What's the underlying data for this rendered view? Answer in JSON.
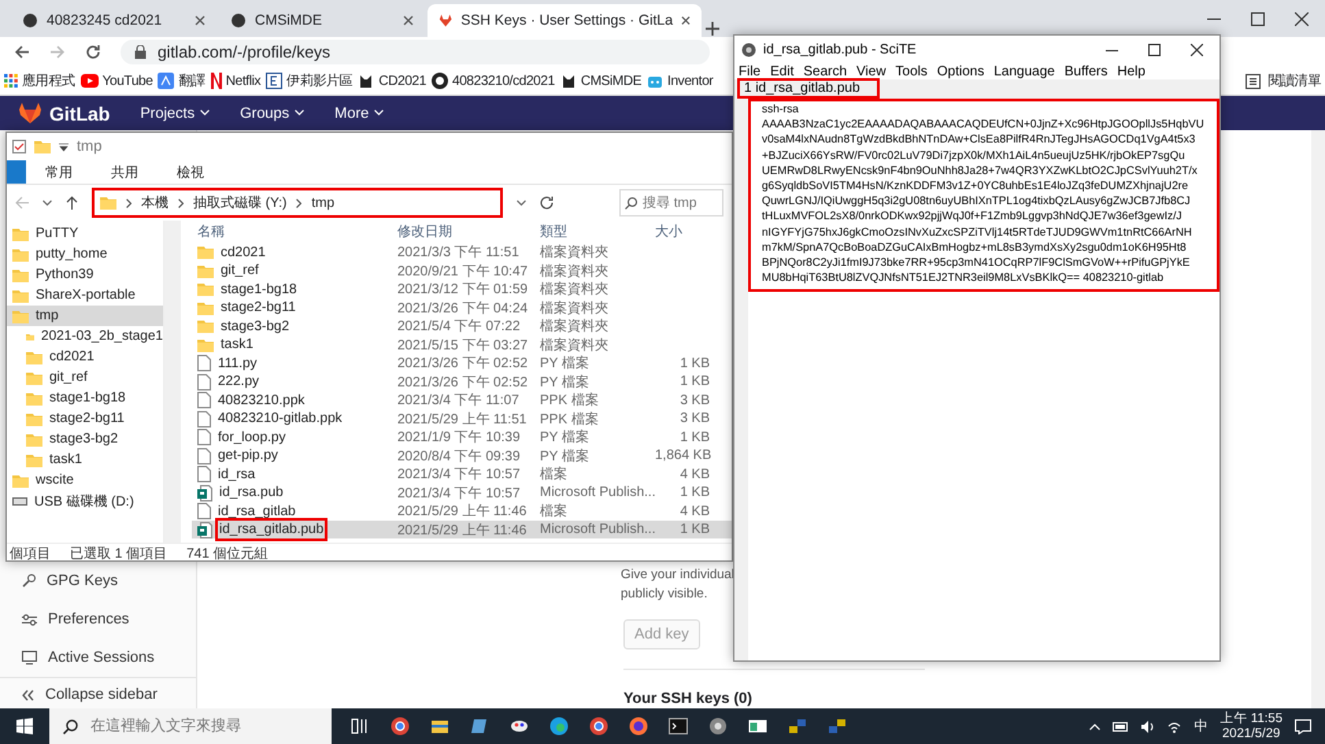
{
  "browser": {
    "tabs": [
      {
        "title": "40823245 cd2021",
        "selected": false
      },
      {
        "title": "CMSiMDE",
        "selected": false
      },
      {
        "title": "SSH Keys · User Settings · GitLa",
        "selected": true
      }
    ],
    "url": "gitlab.com/-/profile/keys",
    "bookmarks": [
      {
        "label": "應用程式",
        "kind": "apps"
      },
      {
        "label": "YouTube",
        "kind": "youtube"
      },
      {
        "label": "翻譯",
        "kind": "translate"
      },
      {
        "label": "Netflix",
        "kind": "netflix"
      },
      {
        "label": "伊莉影片區",
        "kind": "site"
      },
      {
        "label": "CD2021",
        "kind": "cat"
      },
      {
        "label": "40823210/cd2021",
        "kind": "github"
      },
      {
        "label": "CMSiMDE",
        "kind": "cat"
      },
      {
        "label": "Inventor",
        "kind": "bot"
      }
    ],
    "reading_list": "閱讀清單",
    "gitlab": {
      "brand": "GitLab",
      "menus": [
        "Projects",
        "Groups",
        "More"
      ],
      "sidebar": [
        {
          "label": "GPG Keys",
          "kind": "key"
        },
        {
          "label": "Preferences",
          "kind": "prefs"
        },
        {
          "label": "Active Sessions",
          "kind": "sessions"
        },
        {
          "label": "Collapse sidebar",
          "kind": "collapse"
        }
      ],
      "description": [
        "Give your individual",
        "publicly visible."
      ],
      "add_key_button": "Add key",
      "keys_heading": "Your SSH keys (0)"
    }
  },
  "explorer": {
    "title": "tmp",
    "ribbon_tabs": [
      "常用",
      "共用",
      "檢視"
    ],
    "path": [
      "本機",
      "抽取式磁碟 (Y:)",
      "tmp"
    ],
    "search": {
      "placeholder": "搜尋 tmp"
    },
    "tree": [
      {
        "label": "PuTTY",
        "selected": false
      },
      {
        "label": "putty_home",
        "selected": false
      },
      {
        "label": "Python39",
        "selected": false
      },
      {
        "label": "ShareX-portable",
        "selected": false
      },
      {
        "label": "tmp",
        "selected": true,
        "children": [
          {
            "label": "2021-03_2b_stage1",
            "selected": false
          },
          {
            "label": "cd2021",
            "selected": false
          },
          {
            "label": "git_ref",
            "selected": false
          },
          {
            "label": "stage1-bg18",
            "selected": false
          },
          {
            "label": "stage2-bg11",
            "selected": false
          },
          {
            "label": "stage3-bg2",
            "selected": false
          },
          {
            "label": "task1",
            "selected": false
          }
        ]
      },
      {
        "label": "wscite",
        "selected": false
      },
      {
        "label": "USB 磁碟機 (D:)",
        "selected": false,
        "kind": "drive"
      }
    ],
    "columns": [
      "名稱",
      "修改日期",
      "類型",
      "大小"
    ],
    "rows": [
      {
        "name": "cd2021",
        "date": "2021/3/3 下午 11:51",
        "type": "檔案資料夾",
        "kind": "folder",
        "selected": false
      },
      {
        "name": "git_ref",
        "date": "2020/9/21 下午 10:47",
        "type": "檔案資料夾",
        "kind": "folder",
        "selected": false
      },
      {
        "name": "stage1-bg18",
        "date": "2021/3/12 下午 01:59",
        "type": "檔案資料夾",
        "kind": "folder",
        "selected": false
      },
      {
        "name": "stage2-bg11",
        "date": "2021/3/26 下午 04:24",
        "type": "檔案資料夾",
        "kind": "folder",
        "selected": false
      },
      {
        "name": "stage3-bg2",
        "date": "2021/5/4 下午 07:22",
        "type": "檔案資料夾",
        "kind": "folder",
        "selected": false
      },
      {
        "name": "task1",
        "date": "2021/5/15 下午 03:27",
        "type": "檔案資料夾",
        "kind": "folder",
        "selected": false
      },
      {
        "name": "111.py",
        "date": "2021/3/26 下午 02:52",
        "type": "PY 檔案",
        "size": "1 KB",
        "kind": "file",
        "selected": false
      },
      {
        "name": "222.py",
        "date": "2021/3/26 下午 02:52",
        "type": "PY 檔案",
        "size": "1 KB",
        "kind": "file",
        "selected": false
      },
      {
        "name": "40823210.ppk",
        "date": "2021/3/4 下午 11:07",
        "type": "PPK 檔案",
        "size": "3 KB",
        "kind": "file",
        "selected": false
      },
      {
        "name": "40823210-gitlab.ppk",
        "date": "2021/5/29 上午 11:51",
        "type": "PPK 檔案",
        "size": "3 KB",
        "kind": "file",
        "selected": false
      },
      {
        "name": "for_loop.py",
        "date": "2021/1/9 下午 10:39",
        "type": "PY 檔案",
        "size": "1 KB",
        "kind": "file",
        "selected": false
      },
      {
        "name": "get-pip.py",
        "date": "2020/8/4 下午 09:39",
        "type": "PY 檔案",
        "size": "1,864 KB",
        "kind": "file",
        "selected": false
      },
      {
        "name": "id_rsa",
        "date": "2021/3/4 下午 10:57",
        "type": "檔案",
        "size": "4 KB",
        "kind": "file",
        "selected": false
      },
      {
        "name": "id_rsa.pub",
        "date": "2021/3/4 下午 10:57",
        "type": "Microsoft Publish...",
        "size": "1 KB",
        "kind": "publisher",
        "selected": false
      },
      {
        "name": "id_rsa_gitlab",
        "date": "2021/5/29 上午 11:46",
        "type": "檔案",
        "size": "4 KB",
        "kind": "file",
        "selected": false
      },
      {
        "name": "id_rsa_gitlab.pub",
        "date": "2021/5/29 上午 11:46",
        "type": "Microsoft Publish...",
        "size": "1 KB",
        "kind": "publisher",
        "selected": true
      }
    ],
    "status": [
      "個項目",
      "已選取 1 個項目",
      "741 個位元組"
    ]
  },
  "scite": {
    "title": "id_rsa_gitlab.pub - SciTE",
    "menus": [
      "File",
      "Edit",
      "Search",
      "View",
      "Tools",
      "Options",
      "Language",
      "Buffers",
      "Help"
    ],
    "buffer_tab": "1 id_rsa_gitlab.pub",
    "lines": [
      "ssh-rsa",
      "AAAAB3NzaC1yc2EAAAADAQABAAACAQDEUfCN+0JjnZ+Xc96HtpJGOOpllJs5HqbVU",
      "v0saM4lxNAudn8TgWzdBkdBhNTnDAw+ClsEa8PilfR4RnJTegJHsAGOCDq1VgA4t5x3",
      "+BJZuciX66YsRW/FV0rc02LuV79Di7jzpX0k/MXh1AiL4n5ueujUz5HK/rjbOkEP7sgQu",
      "UEMRwD8LRwyENcsk9nF4bn9OuNhh8Ja28+7w4QR3YXZwKLbtO2CJpCSvlYuuh2T/x",
      "g6SyqldbSoVI5TM4HsN/KznKDDFM3v1Z+0YC8uhbEs1E4loJZq3feDUMZXhjnajU2re",
      "QuwrLGNJ/IQiUwggH5q3i2gU08tn6uyUBhIXnTPL1og4tixbQzLAusy6gZwJCB7Jfb8CJ",
      "tHLuxMVFOL2sX8/0nrkODKwx92pjjWqJ0f+F1Zmb9Lggvp3hNdQJE7w36ef3gewIz/J",
      "nIGYFYjG75hxJ6gkCmoOzsINvXuZxcSPZiTVlj14t5RTdeTJUD9GWVm1tnRtC66ArNH",
      "m7kM/SpnA7QcBoBoaDZGuCAIxBmHogbz+mL8sB3ymdXsXy2sgu0dm1oK6H95Ht8",
      "BPjNQor8C2yJi1fmI9J73bke7RR+95cp3mN41OCqRP7lF9ClSmGVoW++rPifuGPjYkE",
      "MU8bHqiT63BtU8lZVQJNfsNT51EJ2TNR3eil9M8LxVsBKlkQ== 40823210-gitlab"
    ]
  },
  "taskbar": {
    "search": {
      "placeholder": "在這裡輸入文字來搜尋"
    },
    "ime": "中",
    "time": "上午 11:55",
    "date": "2021/5/29"
  }
}
